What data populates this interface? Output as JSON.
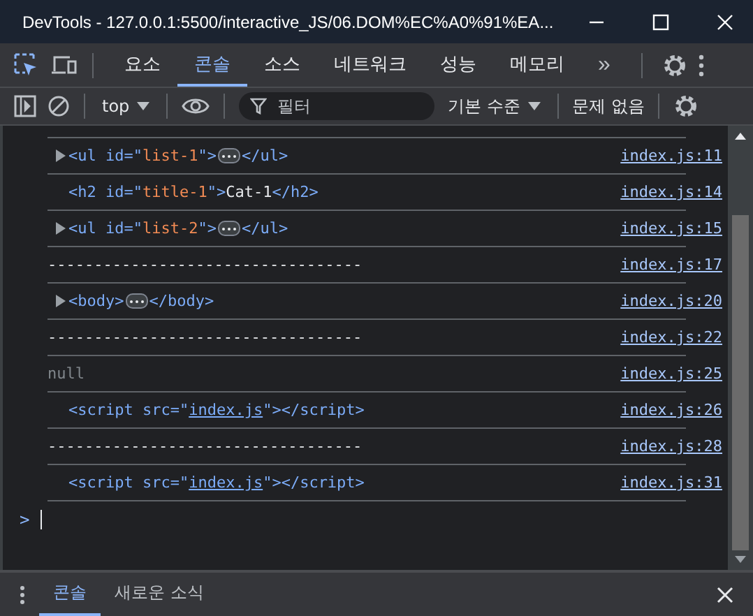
{
  "window": {
    "title": "DevTools - 127.0.0.1:5500/interactive_JS/06.DOM%EC%A0%91%EA..."
  },
  "tabs": [
    {
      "label": "요소",
      "selected": false
    },
    {
      "label": "콘솔",
      "selected": true
    },
    {
      "label": "소스",
      "selected": false
    },
    {
      "label": "네트워크",
      "selected": false
    },
    {
      "label": "성능",
      "selected": false
    },
    {
      "label": "메모리",
      "selected": false
    }
  ],
  "more_tabs": "»",
  "toolbar": {
    "context": "top",
    "filter": {
      "placeholder": "필터"
    },
    "levels": "기본 수준",
    "issues": "문제 없음"
  },
  "console": {
    "rows": [
      {
        "expandable": true,
        "tokens": [
          {
            "kind": "tag",
            "text": "<ul id=\""
          },
          {
            "kind": "value",
            "text": "list-1"
          },
          {
            "kind": "tag",
            "text": "\">"
          },
          {
            "kind": "ellipsis"
          },
          {
            "kind": "tag",
            "text": "</ul>"
          }
        ],
        "source": "index.js:11"
      },
      {
        "expandable": false,
        "tokens": [
          {
            "kind": "tag",
            "text": "<h2 id=\""
          },
          {
            "kind": "value",
            "text": "title-1"
          },
          {
            "kind": "tag",
            "text": "\">"
          },
          {
            "kind": "text",
            "text": "Cat-1"
          },
          {
            "kind": "tag",
            "text": "</h2>"
          }
        ],
        "source": "index.js:14"
      },
      {
        "expandable": true,
        "tokens": [
          {
            "kind": "tag",
            "text": "<ul id=\""
          },
          {
            "kind": "value",
            "text": "list-2"
          },
          {
            "kind": "tag",
            "text": "\">"
          },
          {
            "kind": "ellipsis"
          },
          {
            "kind": "tag",
            "text": "</ul>"
          }
        ],
        "source": "index.js:15"
      },
      {
        "expandable": false,
        "tokens": [
          {
            "kind": "plain",
            "text": "----------------------------------"
          }
        ],
        "source": "index.js:17"
      },
      {
        "expandable": true,
        "tokens": [
          {
            "kind": "tag",
            "text": "<body>"
          },
          {
            "kind": "ellipsis"
          },
          {
            "kind": "tag",
            "text": "</body>"
          }
        ],
        "source": "index.js:20"
      },
      {
        "expandable": false,
        "tokens": [
          {
            "kind": "plain",
            "text": "----------------------------------"
          }
        ],
        "source": "index.js:22"
      },
      {
        "expandable": false,
        "tokens": [
          {
            "kind": "null",
            "text": "null"
          }
        ],
        "source": "index.js:25"
      },
      {
        "expandable": false,
        "tokens": [
          {
            "kind": "tag",
            "text": "<script src=\""
          },
          {
            "kind": "link",
            "text": "index.js"
          },
          {
            "kind": "tag",
            "text": "\"></script>"
          }
        ],
        "source": "index.js:26"
      },
      {
        "expandable": false,
        "tokens": [
          {
            "kind": "plain",
            "text": "----------------------------------"
          }
        ],
        "source": "index.js:28"
      },
      {
        "expandable": false,
        "tokens": [
          {
            "kind": "tag",
            "text": "<script src=\""
          },
          {
            "kind": "link",
            "text": "index.js"
          },
          {
            "kind": "tag",
            "text": "\"></script>"
          }
        ],
        "source": "index.js:31"
      }
    ],
    "prompt": ">"
  },
  "drawer": {
    "tabs": [
      {
        "label": "콘솔",
        "selected": true
      },
      {
        "label": "새로운 소식",
        "selected": false
      }
    ]
  }
}
